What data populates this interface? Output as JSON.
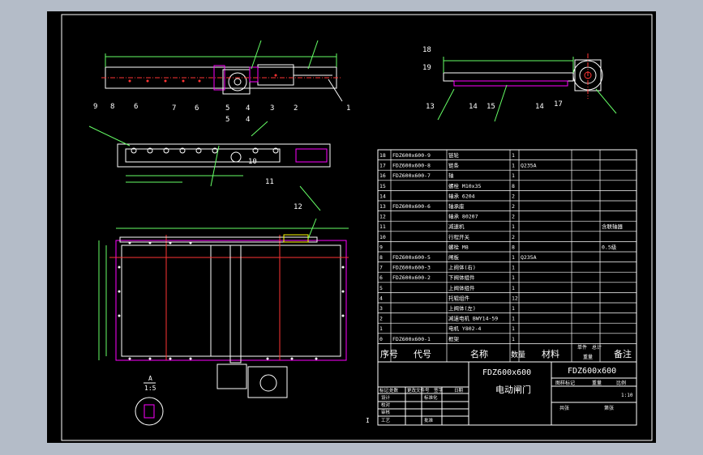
{
  "colors": {
    "page_bg": "#b4bcc8",
    "frame_bg": "#000000",
    "line": "#ffffff",
    "dim": "#66ff66",
    "part": "#ff00ff",
    "center": "#ff3333",
    "accent": "#ffff00",
    "label": "#00ffff"
  },
  "title_block": {
    "model": "FDZ600x600",
    "name": "电动闸门",
    "model_right": "FDZ600x600",
    "scale": "1:10"
  },
  "bom": {
    "headers": [
      "序号",
      "代号",
      "名称",
      "数量",
      "材料",
      "单件",
      "总计",
      "备注"
    ],
    "weight_label": "重量",
    "rows": [
      {
        "no": "18",
        "code": "FDZ600x600-9",
        "name": "链轮",
        "qty": "1",
        "mat": "",
        "note": ""
      },
      {
        "no": "17",
        "code": "FDZ600x600-8",
        "name": "链条",
        "qty": "1",
        "mat": "Q235A",
        "note": ""
      },
      {
        "no": "16",
        "code": "FDZ600x600-7",
        "name": "轴",
        "qty": "1",
        "mat": "",
        "note": ""
      },
      {
        "no": "15",
        "code": "",
        "name": "螺栓 M10x35",
        "qty": "8",
        "mat": "",
        "note": ""
      },
      {
        "no": "14",
        "code": "",
        "name": "轴承 6204",
        "qty": "2",
        "mat": "",
        "note": ""
      },
      {
        "no": "13",
        "code": "FDZ600x600-6",
        "name": "轴承座",
        "qty": "2",
        "mat": "",
        "note": ""
      },
      {
        "no": "12",
        "code": "",
        "name": "轴承 80207",
        "qty": "2",
        "mat": "",
        "note": ""
      },
      {
        "no": "11",
        "code": "",
        "name": "减速机",
        "qty": "1",
        "mat": "",
        "note": "含联轴器"
      },
      {
        "no": "10",
        "code": "",
        "name": "行程开关",
        "qty": "2",
        "mat": "",
        "note": ""
      },
      {
        "no": "9",
        "code": "",
        "name": "螺栓 M8",
        "qty": "8",
        "mat": "",
        "note": "0.5级"
      },
      {
        "no": "8",
        "code": "FDZ600x600-5",
        "name": "闸板",
        "qty": "1",
        "mat": "Q235A",
        "note": ""
      },
      {
        "no": "7",
        "code": "FDZ600x600-3",
        "name": "上阀体(右)",
        "qty": "1",
        "mat": "",
        "note": ""
      },
      {
        "no": "6",
        "code": "FDZ600x600-2",
        "name": "下阀体组件",
        "qty": "1",
        "mat": "",
        "note": ""
      },
      {
        "no": "5",
        "code": "",
        "name": "上阀体组件",
        "qty": "1",
        "mat": "",
        "note": ""
      },
      {
        "no": "4",
        "code": "",
        "name": "托辊组件",
        "qty": "12",
        "mat": "",
        "note": ""
      },
      {
        "no": "3",
        "code": "",
        "name": "上阀体(左)",
        "qty": "1",
        "mat": "",
        "note": ""
      },
      {
        "no": "2",
        "code": "",
        "name": "减速电机 BWY14-59",
        "qty": "1",
        "mat": "",
        "note": ""
      },
      {
        "no": "1",
        "code": "",
        "name": "电机 Y802-4",
        "qty": "1",
        "mat": "",
        "note": ""
      },
      {
        "no": "0",
        "code": "FDZ600x600-1",
        "name": "框架",
        "qty": "1",
        "mat": "",
        "note": ""
      }
    ]
  },
  "stage_labels": [
    "图样标记",
    "重量",
    "比例"
  ],
  "sign_labels": [
    "标记",
    "处数",
    "更改文件号",
    "签字",
    "日期",
    "设计",
    "校对",
    "审核",
    "工艺",
    "批准",
    "标准化"
  ],
  "sheet_labels": [
    "共张",
    "第张"
  ],
  "balloons": {
    "top_view": [
      "1",
      "2",
      "3",
      "4",
      "5"
    ],
    "side_view": [
      "9",
      "8",
      "6",
      "7",
      "6",
      "5",
      "4",
      "10",
      "11"
    ],
    "right_view": [
      "18",
      "19",
      "13",
      "14",
      "15",
      "14",
      "17"
    ],
    "bottom_view": [
      "12"
    ]
  },
  "detail": {
    "label": "A",
    "scale": "1:5"
  },
  "section_mark": "I"
}
